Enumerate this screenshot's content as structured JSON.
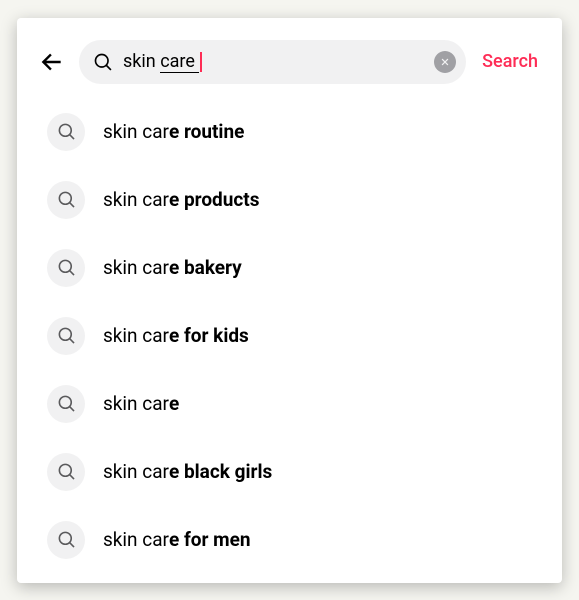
{
  "search": {
    "query": "skin care",
    "action_label": "Search"
  },
  "suggestions": [
    {
      "prefix": "skin car",
      "bold": "e routine"
    },
    {
      "prefix": "skin car",
      "bold": "e products"
    },
    {
      "prefix": "skin car",
      "bold": "e bakery"
    },
    {
      "prefix": "skin car",
      "bold": "e for kids"
    },
    {
      "prefix": "skin car",
      "bold": "e"
    },
    {
      "prefix": "skin car",
      "bold": "e black girls"
    },
    {
      "prefix": "skin car",
      "bold": "e for men"
    }
  ]
}
